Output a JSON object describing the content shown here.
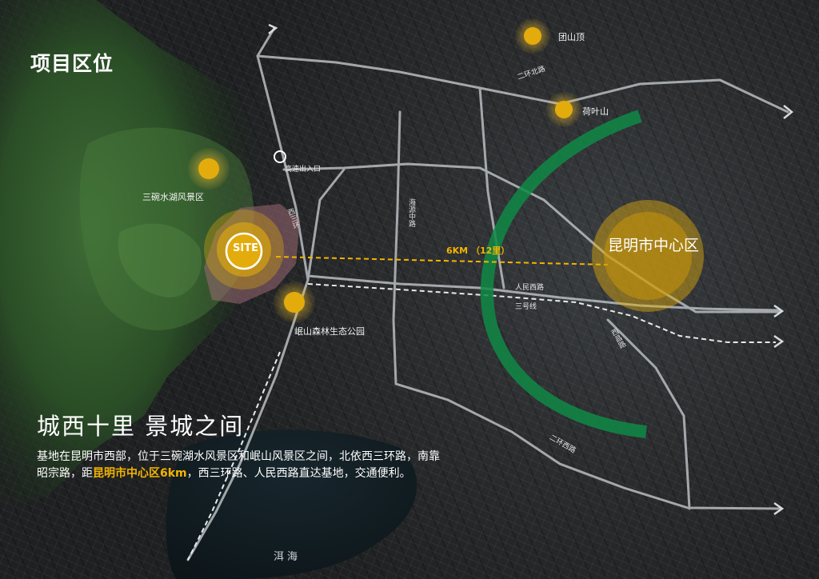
{
  "title": "项目区位",
  "headline": "城西十里    景城之间",
  "description": {
    "part1": "基地在昆明市西部，位于三碗湖水风景区和岷山风景区之间，北依西三环路，南靠昭宗路，距",
    "highlight": "昆明市中心区6km",
    "part2": "，西三环路、人民西路直达基地，交通便利。"
  },
  "distance_label": "6KM  （12里）",
  "site_label": "SITE",
  "city_center_label": "昆明市中心区",
  "places": {
    "tuanshanding": "团山顶",
    "heyeshan": "荷叶山",
    "sanwan": "三碗水湖风景区",
    "minshan": "岷山森林生态公园",
    "highway_exit": "高速出入口",
    "erhai": "洱海"
  },
  "roads": {
    "second_ring_north": "二环北路",
    "second_ring_west": "二环西路",
    "haiyuan_middle": "海源中路",
    "western_third_ring": "西三环",
    "renmin_west": "人民西路",
    "metro_line3": "三号线",
    "xichang": "西昌路"
  },
  "colors": {
    "accent_yellow": "#f4b400",
    "marker_yellow": "#e3ac0c",
    "green_arc": "#0f8a45",
    "road": "#b9bec2"
  }
}
